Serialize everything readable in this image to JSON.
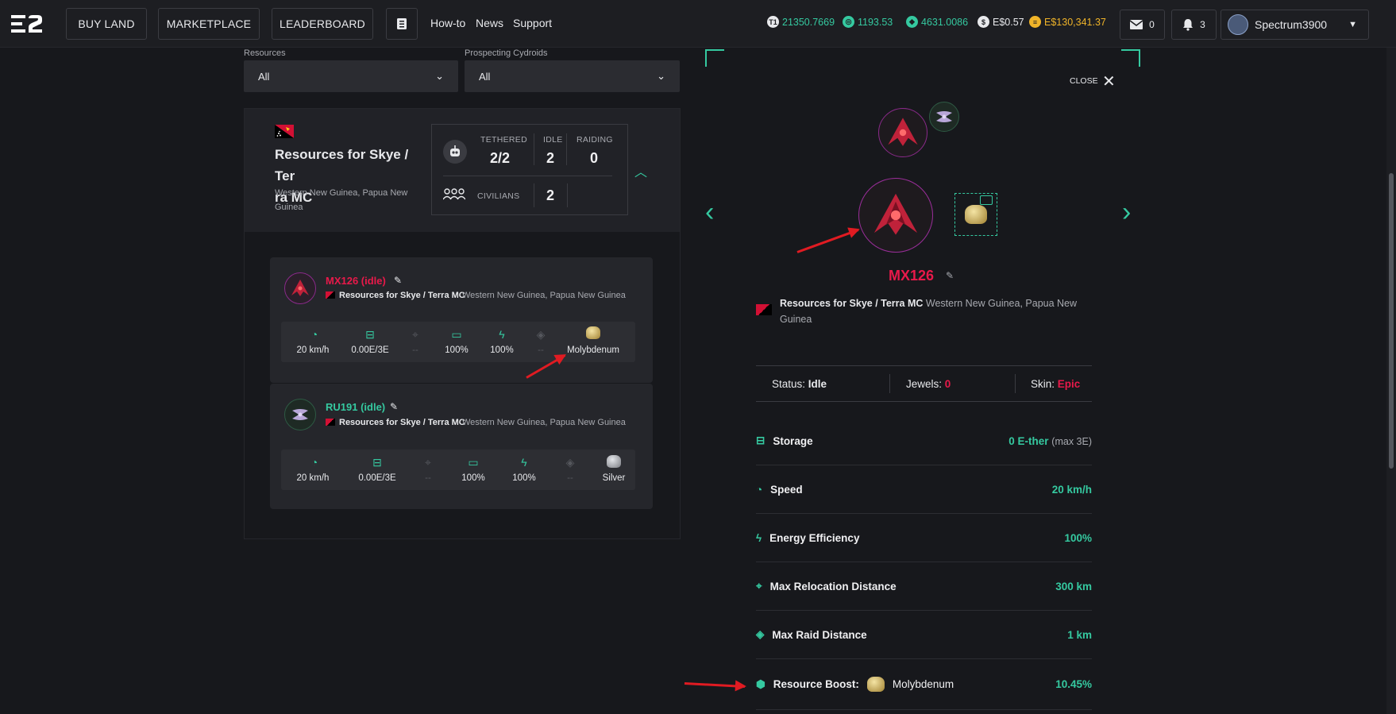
{
  "nav": {
    "buy_land": "BUY LAND",
    "marketplace": "MARKETPLACE",
    "leaderboard": "LEADERBOARD",
    "howto": "How-to",
    "news": "News",
    "support": "Support"
  },
  "balances": {
    "t1": "21350.7669",
    "b2": "1193.53",
    "b3": "4631.0086",
    "usd": "E$0.57",
    "gold": "E$130,341.37"
  },
  "notifications": {
    "mail": "0",
    "bell": "3"
  },
  "user": {
    "name": "Spectrum3900"
  },
  "filters": {
    "resources_label": "Resources",
    "resources_value": "All",
    "cydroids_label": "Prospecting Cydroids",
    "cydroids_value": "All"
  },
  "property": {
    "title_line1": "Resources for Skye / Ter",
    "title_line2": "ra MC",
    "location_line1": "Western New Guinea, Papua New",
    "location_line2": "Guinea",
    "tethered_label": "TETHERED",
    "tethered_value": "2/2",
    "idle_label": "IDLE",
    "idle_value": "2",
    "raiding_label": "RAIDING",
    "raiding_value": "0",
    "civilians_label": "CIVILIANS",
    "civilians_value": "2"
  },
  "cydroids": [
    {
      "name": "MX126 (idle)",
      "property": "Resources for Skye / Terra MC",
      "location": "Western New Guinea, Papua New Guinea",
      "speed": "20 km/h",
      "storage": "0.00E/3E",
      "relocation": "--",
      "battery": "100%",
      "efficiency": "100%",
      "raid": "--",
      "resource": "Molybdenum"
    },
    {
      "name": "RU191 (idle)",
      "property": "Resources for Skye / Terra MC",
      "location": "Western New Guinea, Papua New Guinea",
      "speed": "20 km/h",
      "storage": "0.00E/3E",
      "relocation": "--",
      "battery": "100%",
      "efficiency": "100%",
      "raid": "--",
      "resource": "Silver"
    }
  ],
  "detail": {
    "close": "CLOSE",
    "name": "MX126",
    "property": "Resources for Skye / Terra MC",
    "location_line1": "Western New Guinea, Papua New",
    "location_line2": "Guinea",
    "status_label": "Status:",
    "status_value": "Idle",
    "jewels_label": "Jewels:",
    "jewels_value": "0",
    "skin_label": "Skin:",
    "skin_value": "Epic",
    "storage_label": "Storage",
    "storage_value": "0 E-ther",
    "storage_max": "(max 3E)",
    "speed_label": "Speed",
    "speed_value": "20 km/h",
    "efficiency_label": "Energy Efficiency",
    "efficiency_value": "100%",
    "relocation_label": "Max Relocation Distance",
    "relocation_value": "300 km",
    "raid_label": "Max Raid Distance",
    "raid_value": "1 km",
    "boost_label": "Resource Boost:",
    "boost_resource": "Molybdenum",
    "boost_value": "10.45%"
  },
  "colors": {
    "accent": "#35c9a0",
    "red": "#e8194a",
    "gold": "#f0b429",
    "bg": "#17181c"
  }
}
